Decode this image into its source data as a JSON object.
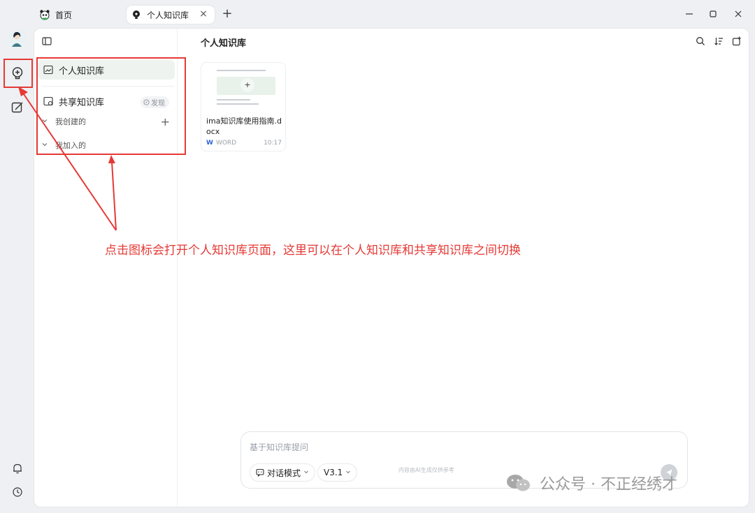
{
  "tabs": [
    {
      "label": "首页",
      "icon": "panda-icon"
    },
    {
      "label": "个人知识库",
      "icon": "lightbulb-icon"
    }
  ],
  "tab_close": "×",
  "new_tab": "+",
  "sidebar": {
    "personal_label": "个人知识库",
    "shared_label": "共享知识库",
    "discover_label": "发现",
    "created_label": "我创建的",
    "joined_label": "我加入的",
    "add": "+"
  },
  "content": {
    "title": "个人知识库",
    "file": {
      "name": "ima知识库使用指南.docx",
      "type": "WORD",
      "time": "10:17",
      "type_icon": "W"
    }
  },
  "ask": {
    "placeholder": "基于知识库提问",
    "mode_label": "对话模式",
    "version_label": "V3.1"
  },
  "disclaimer": "内容由AI生成仅供参考",
  "annotation": "点击图标会打开个人知识库页面，这里可以在个人知识库和共享知识库之间切换",
  "watermark": "公众号 · 不正经绣才",
  "colors": {
    "annotation": "#e53935",
    "accent_bg": "#eef3ef"
  }
}
